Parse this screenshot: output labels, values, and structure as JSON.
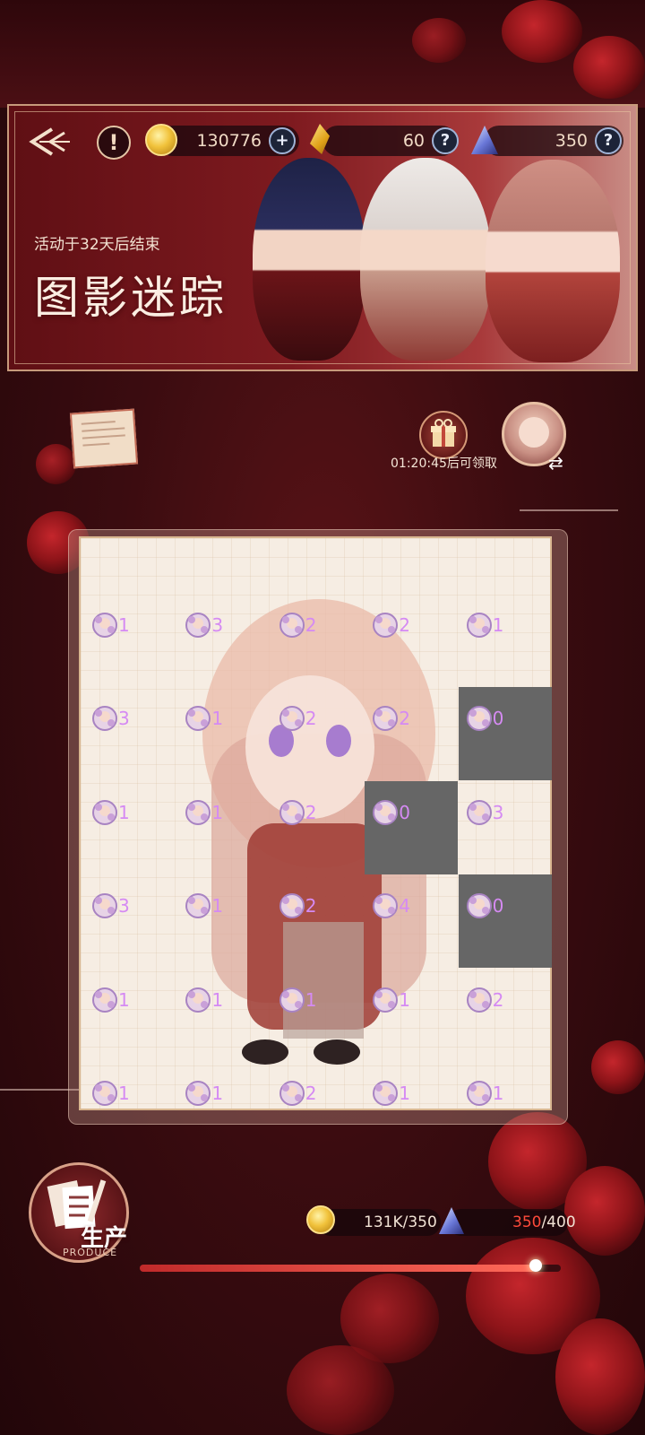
{
  "currency": {
    "gold": "130776",
    "amber": "60",
    "crystal": "350"
  },
  "event": {
    "countdown": "活动于32天后结束",
    "title": "图影迷踪"
  },
  "gift": {
    "timer": "01:20:45后可领取"
  },
  "board": {
    "rows": [
      [
        {
          "count": "1",
          "hidden": false
        },
        {
          "count": "3",
          "hidden": false
        },
        {
          "count": "2",
          "hidden": false
        },
        {
          "count": "2",
          "hidden": false
        },
        {
          "count": "1",
          "hidden": false
        }
      ],
      [
        {
          "count": "3",
          "hidden": false
        },
        {
          "count": "1",
          "hidden": false
        },
        {
          "count": "2",
          "hidden": false
        },
        {
          "count": "2",
          "hidden": false
        },
        {
          "count": "0",
          "hidden": true
        }
      ],
      [
        {
          "count": "1",
          "hidden": false
        },
        {
          "count": "1",
          "hidden": false
        },
        {
          "count": "2",
          "hidden": false
        },
        {
          "count": "0",
          "hidden": true
        },
        {
          "count": "3",
          "hidden": false
        }
      ],
      [
        {
          "count": "3",
          "hidden": false
        },
        {
          "count": "1",
          "hidden": false
        },
        {
          "count": "2",
          "hidden": false
        },
        {
          "count": "4",
          "hidden": false
        },
        {
          "count": "0",
          "hidden": true
        }
      ],
      [
        {
          "count": "1",
          "hidden": false
        },
        {
          "count": "1",
          "hidden": false
        },
        {
          "count": "1",
          "hidden": false
        },
        {
          "count": "1",
          "hidden": false
        },
        {
          "count": "2",
          "hidden": false
        }
      ],
      [
        {
          "count": "1",
          "hidden": false
        },
        {
          "count": "1",
          "hidden": false
        },
        {
          "count": "2",
          "hidden": false
        },
        {
          "count": "1",
          "hidden": false
        },
        {
          "count": "1",
          "hidden": false
        }
      ]
    ]
  },
  "produce": {
    "label": "生产",
    "sub_label": "PRODUCE",
    "gold_progress": "131K/350",
    "crystal_current": "350",
    "crystal_max": "/400",
    "progress": 0.94
  },
  "colors": {
    "accent": "#c02a2a",
    "count_text": "#d58af3",
    "hidden_tile": "#666666"
  }
}
